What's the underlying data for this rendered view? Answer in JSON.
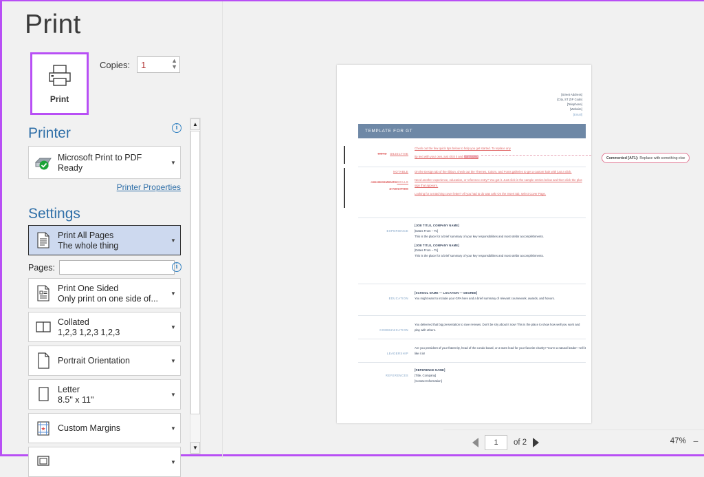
{
  "window": {
    "title": "Print"
  },
  "accent": {
    "purple": "#b84ff5",
    "blue": "#2f6fa8",
    "banner": "#6e88a6",
    "comment": "#e07a95"
  },
  "print_button": {
    "label": "Print",
    "icon": "printer-icon"
  },
  "copies": {
    "label": "Copies:",
    "value": "1"
  },
  "printer": {
    "heading": "Printer",
    "name": "Microsoft Print to PDF",
    "status": "Ready",
    "properties_link": "Printer Properties",
    "info_icon": "info-icon"
  },
  "settings": {
    "heading": "Settings",
    "pages_label": "Pages:",
    "pages_value": "",
    "pages_placeholder": "",
    "items": [
      {
        "icon": "all-pages-icon",
        "title": "Print All Pages",
        "sub": "The whole thing",
        "selected": true
      },
      {
        "icon": "one-sided-icon",
        "title": "Print One Sided",
        "sub": "Only print on one side of...",
        "selected": false
      },
      {
        "icon": "collated-icon",
        "title": "Collated",
        "sub": "1,2,3    1,2,3    1,2,3",
        "selected": false
      },
      {
        "icon": "portrait-icon",
        "title": "Portrait Orientation",
        "sub": "",
        "selected": false
      },
      {
        "icon": "paper-size-icon",
        "title": "Letter",
        "sub": "8.5\" x 11\"",
        "selected": false
      },
      {
        "icon": "margins-icon",
        "title": "Custom Margins",
        "sub": "",
        "selected": false
      }
    ]
  },
  "scrollbar": {
    "up_icon": "scroll-up-arrow",
    "down_icon": "scroll-down-arrow"
  },
  "document": {
    "contact": [
      "[Street Address]",
      "[City, ST ZIP Code]",
      "[Telephone]",
      "[Website]",
      "[Email]"
    ],
    "banner_title": "TEMPLATE FOR GT",
    "goal": {
      "label_strike": "GOAL",
      "label_rest": "OBJECTIVE",
      "line1": "Check out the few quick tips below to help you get started. To replace any",
      "line2a": "tip text with your own, just click it and ",
      "line2b": "start typing"
    },
    "notable": {
      "l1": "NOTABLE",
      "l2a": "ACHIEVEMENTS",
      "l2b": "SKILLS",
      "l3": "& ABILITIES",
      "p1": "On the Design tab of the ribbon, check out the Themes, Colors, and Fonts galleries to get a custom look with just a click.",
      "p2": "Need another experience, education, or reference entry? You got it. Just click in the sample entries below and then click the plus sign that appears.",
      "p3": "Looking for a matching cover letter? All you had to do was ask! On the Insert tab, select Cover Page."
    },
    "experience": {
      "label": "EXPERIENCE",
      "jobs": [
        {
          "title": "[JOB TITLE, COMPANY NAME]",
          "dates": "[Dates From – To]",
          "desc": "This is the place for a brief summary of your key responsibilities and most stellar accomplishments."
        },
        {
          "title": "[JOB TITLE, COMPANY NAME]",
          "dates": "[Dates From – To]",
          "desc": "This is the place for a brief summary of your key responsibilities and most stellar accomplishments."
        }
      ]
    },
    "education": {
      "label": "EDUCATION",
      "title": "[SCHOOL NAME — LOCATION — DEGREE]",
      "desc": "You might want to include your GPA here and a brief summary of relevant coursework, awards, and honors."
    },
    "communication": {
      "label": "COMMUNICATION",
      "desc": "You delivered that big presentation to rave reviews. Don't be shy about it now! This is the place to show how well you work and play with others."
    },
    "leadership": {
      "label": "LEADERSHIP",
      "desc": "Are you president of your fraternity, head of the condo board, or a team lead for your favorite charity? You're a natural leader—tell it like it is!"
    },
    "references": {
      "label": "REFERENCES",
      "name": "[REFERENCE NAME]",
      "title": "[Title, Company]",
      "contact": "[Contact Information]"
    },
    "comment": {
      "author": "Commented [AF1]:",
      "text": "Replace with something else"
    }
  },
  "statusbar": {
    "prev_icon": "previous-page-arrow",
    "next_icon": "next-page-arrow",
    "current_page": "1",
    "of_label": "of 2",
    "zoom_level": "47%",
    "zoom_out_icon": "zoom-out-icon"
  }
}
